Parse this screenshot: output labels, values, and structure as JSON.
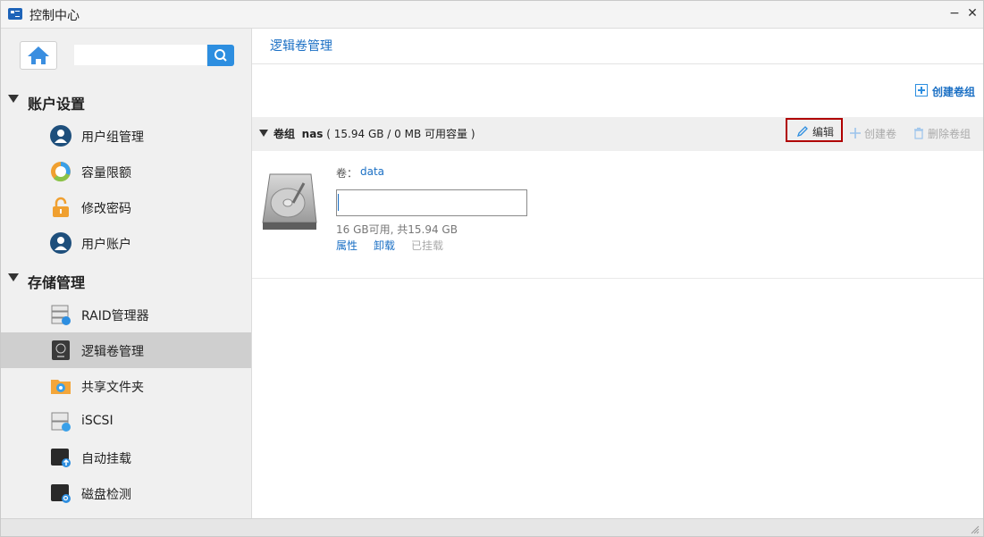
{
  "window": {
    "title": "控制中心",
    "minimize_glyph": "−",
    "close_glyph": "✕"
  },
  "sidebar": {
    "search": {
      "value": "",
      "placeholder": ""
    },
    "sections": [
      {
        "label": "账户设置",
        "items": [
          {
            "label": "用户组管理",
            "icon": "user-group-icon"
          },
          {
            "label": "容量限额",
            "icon": "quota-icon"
          },
          {
            "label": "修改密码",
            "icon": "lock-icon"
          },
          {
            "label": "用户账户",
            "icon": "user-account-icon"
          }
        ]
      },
      {
        "label": "存储管理",
        "items": [
          {
            "label": "RAID管理器",
            "icon": "raid-icon"
          },
          {
            "label": "逻辑卷管理",
            "icon": "lvm-icon",
            "active": true
          },
          {
            "label": "共享文件夹",
            "icon": "shared-folder-icon"
          },
          {
            "label": "iSCSI",
            "icon": "iscsi-icon"
          },
          {
            "label": "自动挂载",
            "icon": "auto-mount-icon"
          },
          {
            "label": "磁盘检测",
            "icon": "disk-check-icon"
          }
        ]
      }
    ]
  },
  "main": {
    "breadcrumb": "逻辑卷管理",
    "create_group_label": "创建卷组",
    "volume_group": {
      "prefix": "卷组",
      "name": "nas",
      "capacity": "( 15.94 GB / 0 MB 可用容量 )",
      "actions": {
        "edit": "编辑",
        "create_volume": "创建卷",
        "delete_group": "删除卷组"
      }
    },
    "volume": {
      "label": "卷：",
      "name": "data",
      "input_value": "",
      "capacity_text": "16 GB可用, 共15.94 GB",
      "links": {
        "properties": "属性",
        "unmount": "卸载",
        "mounted": "已挂载"
      }
    }
  },
  "colors": {
    "accent": "#2d8ee0",
    "link": "#1a6fc4",
    "highlight_border": "#b00000",
    "disabled": "#aaaaaa"
  }
}
